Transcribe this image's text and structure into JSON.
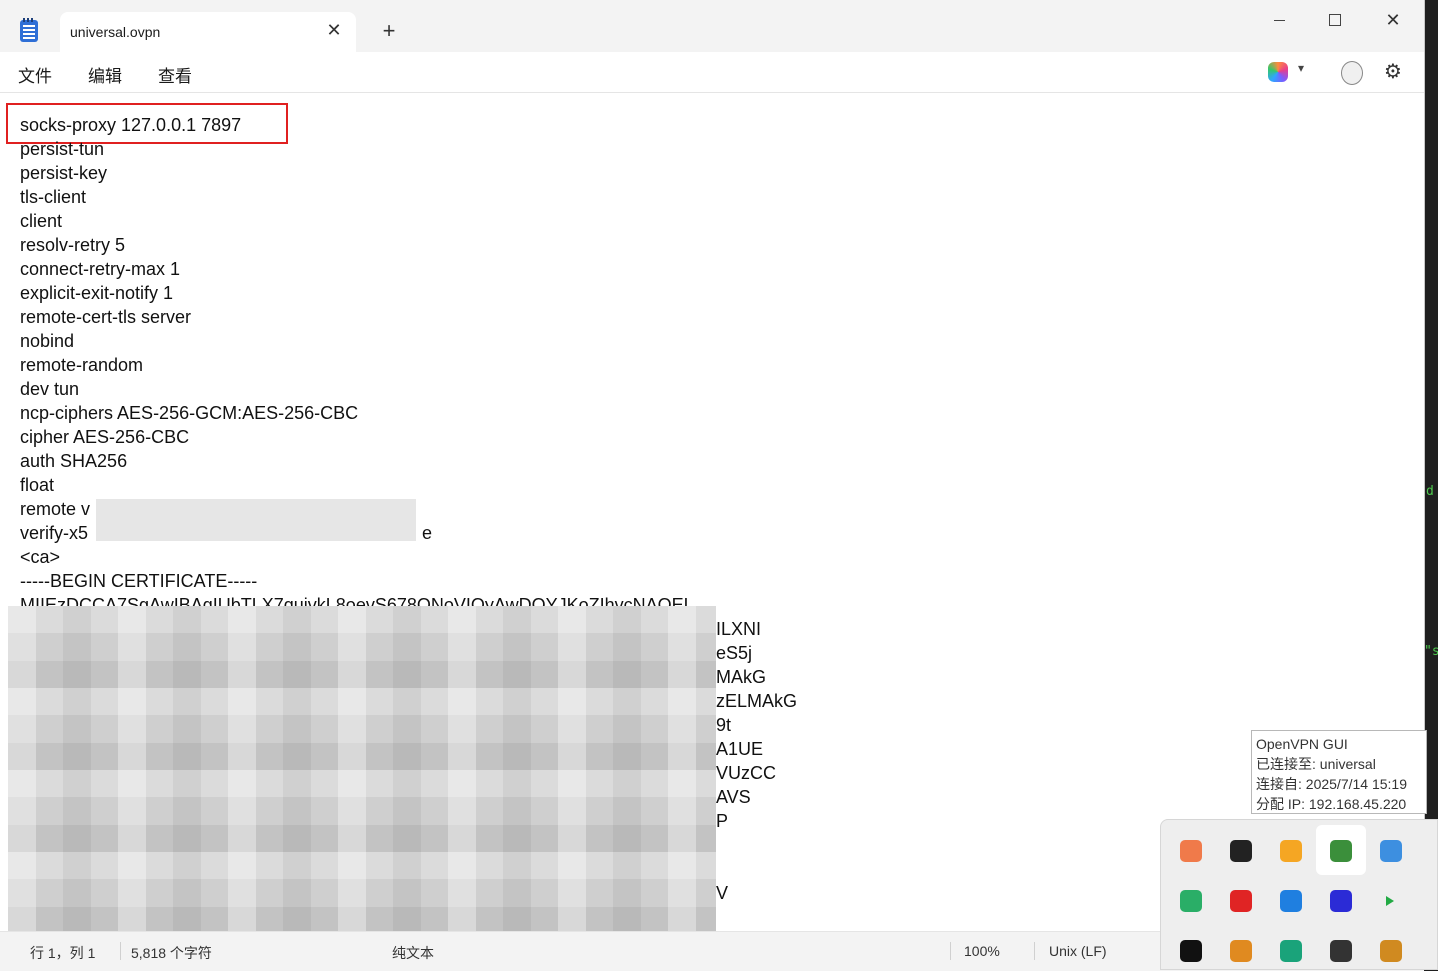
{
  "window": {
    "tab_title": "universal.ovpn",
    "new_tab_glyph": "+",
    "close_tab_glyph": "✕",
    "close_window_glyph": "✕"
  },
  "menu": {
    "items": [
      "文件",
      "编辑",
      "查看"
    ]
  },
  "editor": {
    "highlighted_line": "socks-proxy 127.0.0.1 7897",
    "lines": [
      "persist-tun",
      "persist-key",
      "tls-client",
      "client",
      "resolv-retry 5",
      "connect-retry-max 1",
      "explicit-exit-notify 1",
      "remote-cert-tls server",
      "nobind",
      "remote-random",
      "dev tun",
      "ncp-ciphers AES-256-GCM:AES-256-CBC",
      "cipher AES-256-CBC",
      "auth SHA256",
      "float",
      "remote v",
      "verify-x5",
      "<ca>",
      "-----BEGIN CERTIFICATE-----",
      "MIIEzDCCA7SgAwIBAgIUbTLX7quivkL8oevS678ONoVIOyAwDOYJKoZIhvcNAOEL"
    ],
    "verify_tail": "e",
    "partial_tails": [
      "ILXNI",
      "eS5j",
      "MAkG",
      "zELMAkG",
      "9t",
      "A1UE",
      "VUzCC",
      "AVS",
      "P",
      "",
      "",
      "V"
    ]
  },
  "status_bar": {
    "position": "行 1，列 1",
    "char_count": "5,818 个字符",
    "format": "纯文本",
    "zoom": "100%",
    "line_ending": "Unix (LF)"
  },
  "tooltip": {
    "lines": [
      "OpenVPN GUI",
      "已连接至: universal",
      "连接自: 2025/7/14 15:19",
      "分配 IP: 192.168.45.220"
    ]
  },
  "tray": {
    "icons": [
      {
        "name": "cat-icon",
        "color": "#f07a4a"
      },
      {
        "name": "sliders-icon",
        "color": "#222222"
      },
      {
        "name": "fruit-check-icon",
        "color": "#f5a623"
      },
      {
        "name": "openvpn-monitor-icon",
        "color": "#3b8f3b"
      },
      {
        "name": "photo-icon",
        "color": "#3d8fe0"
      },
      {
        "name": "wechat-icon",
        "color": "#2aae67"
      },
      {
        "name": "chart-app-icon",
        "color": "#e02424"
      },
      {
        "name": "lightning-app-icon",
        "color": "#1f7fe0"
      },
      {
        "name": "chat-app-icon",
        "color": "#2b2bd6"
      },
      {
        "name": "play-arrow-icon",
        "color": "#22aa44"
      },
      {
        "name": "bookmark-icon",
        "color": "#111111"
      },
      {
        "name": "search-circle-icon",
        "color": "#e08a20"
      },
      {
        "name": "edge-icon",
        "color": "#1aa37a"
      },
      {
        "name": "usb-drive-icon",
        "color": "#333333"
      },
      {
        "name": "window-app-icon",
        "color": "#d08a20"
      }
    ]
  }
}
